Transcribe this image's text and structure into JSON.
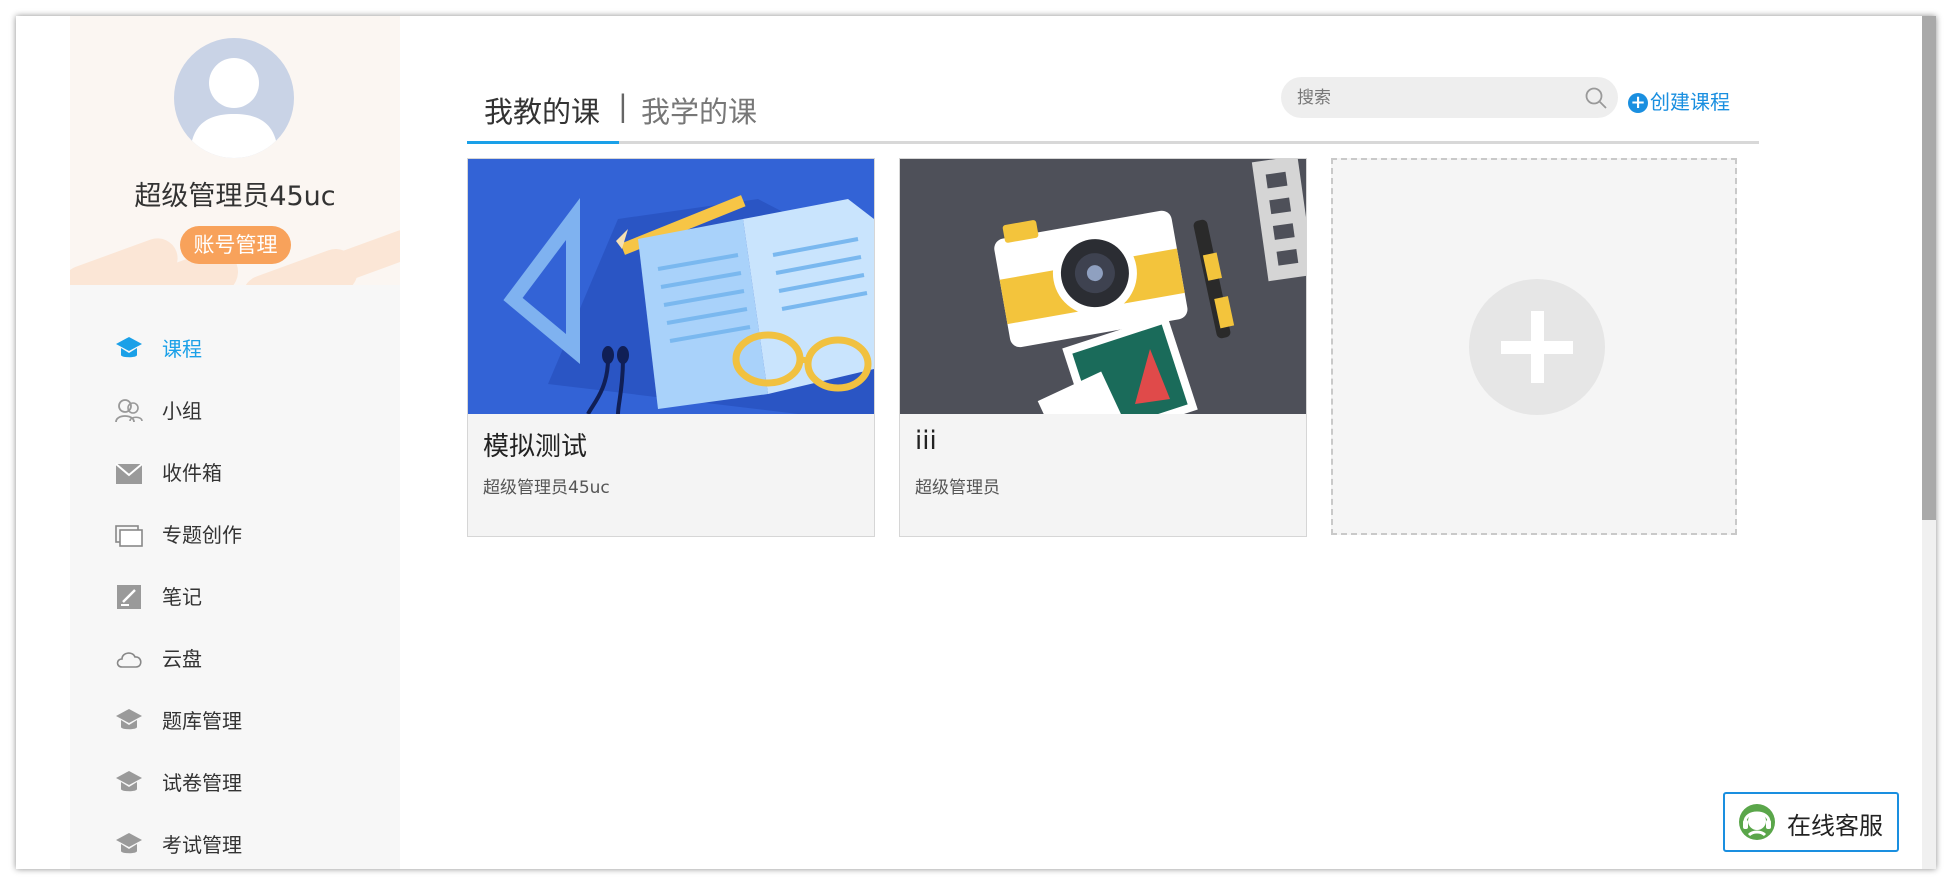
{
  "profile": {
    "username": "超级管理员45uc",
    "account_button": "账号管理"
  },
  "nav": {
    "items": [
      {
        "label": "课程",
        "icon": "course-icon",
        "active": true
      },
      {
        "label": "小组",
        "icon": "group-icon"
      },
      {
        "label": "收件箱",
        "icon": "inbox-icon"
      },
      {
        "label": "专题创作",
        "icon": "topic-icon"
      },
      {
        "label": "笔记",
        "icon": "note-icon"
      },
      {
        "label": "云盘",
        "icon": "cloud-icon"
      },
      {
        "label": "题库管理",
        "icon": "question-bank-icon"
      },
      {
        "label": "试卷管理",
        "icon": "exam-paper-icon"
      },
      {
        "label": "考试管理",
        "icon": "exam-icon"
      }
    ]
  },
  "tabs": {
    "teach": "我教的课",
    "separator": "|",
    "learn": "我学的课"
  },
  "search": {
    "placeholder": "搜索"
  },
  "create_course": "创建课程",
  "courses": [
    {
      "title": "模拟测试",
      "author": "超级管理员45uc",
      "thumbnail": "book-illustration"
    },
    {
      "title": "iii",
      "author": "超级管理员",
      "thumbnail": "camera-illustration"
    }
  ],
  "online_service": "在线客服",
  "colors": {
    "accent": "#1aa0e8",
    "account_button": "#f8a25b",
    "card_blue": "#3363d6",
    "card_dark": "#4e5059"
  }
}
